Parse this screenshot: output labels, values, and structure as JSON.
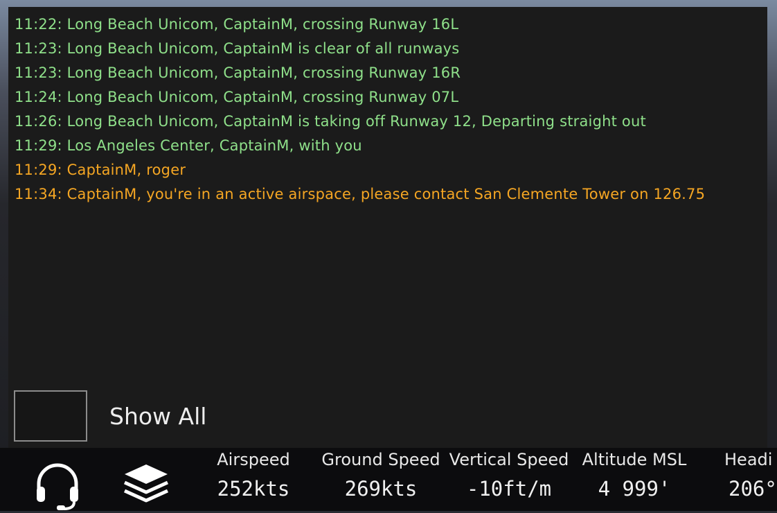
{
  "chat": {
    "messages": [
      {
        "text": "11:22: Long Beach Unicom, CaptainM, crossing Runway 16L",
        "color": "#8fe08a"
      },
      {
        "text": "11:23: Long Beach Unicom, CaptainM is clear of all runways",
        "color": "#8fe08a"
      },
      {
        "text": "11:23: Long Beach Unicom, CaptainM, crossing Runway 16R",
        "color": "#8fe08a"
      },
      {
        "text": "11:24: Long Beach Unicom, CaptainM, crossing Runway 07L",
        "color": "#8fe08a"
      },
      {
        "text": "11:26: Long Beach Unicom, CaptainM is taking off Runway 12, Departing straight out",
        "color": "#8fe08a"
      },
      {
        "text": "11:29: Los Angeles Center, CaptainM, with you",
        "color": "#8fe08a"
      },
      {
        "text": "11:29: CaptainM, roger",
        "color": "#f5a623"
      },
      {
        "text": "11:34: CaptainM, you're in an active airspace,  please contact San Clemente Tower on 126.75",
        "color": "#f5a623"
      }
    ],
    "show_all_label": "Show All",
    "show_all_checked": false
  },
  "bottom_bar": {
    "icons": [
      "headset-icon",
      "layers-icon"
    ],
    "metrics": [
      {
        "label": "Airspeed",
        "value": "252kts"
      },
      {
        "label": "Ground Speed",
        "value": "269kts"
      },
      {
        "label": "Vertical Speed",
        "value": "-10ft/m"
      },
      {
        "label": "Altitude MSL",
        "value": "4 999'"
      },
      {
        "label": "Headi",
        "value": "206°"
      }
    ]
  }
}
